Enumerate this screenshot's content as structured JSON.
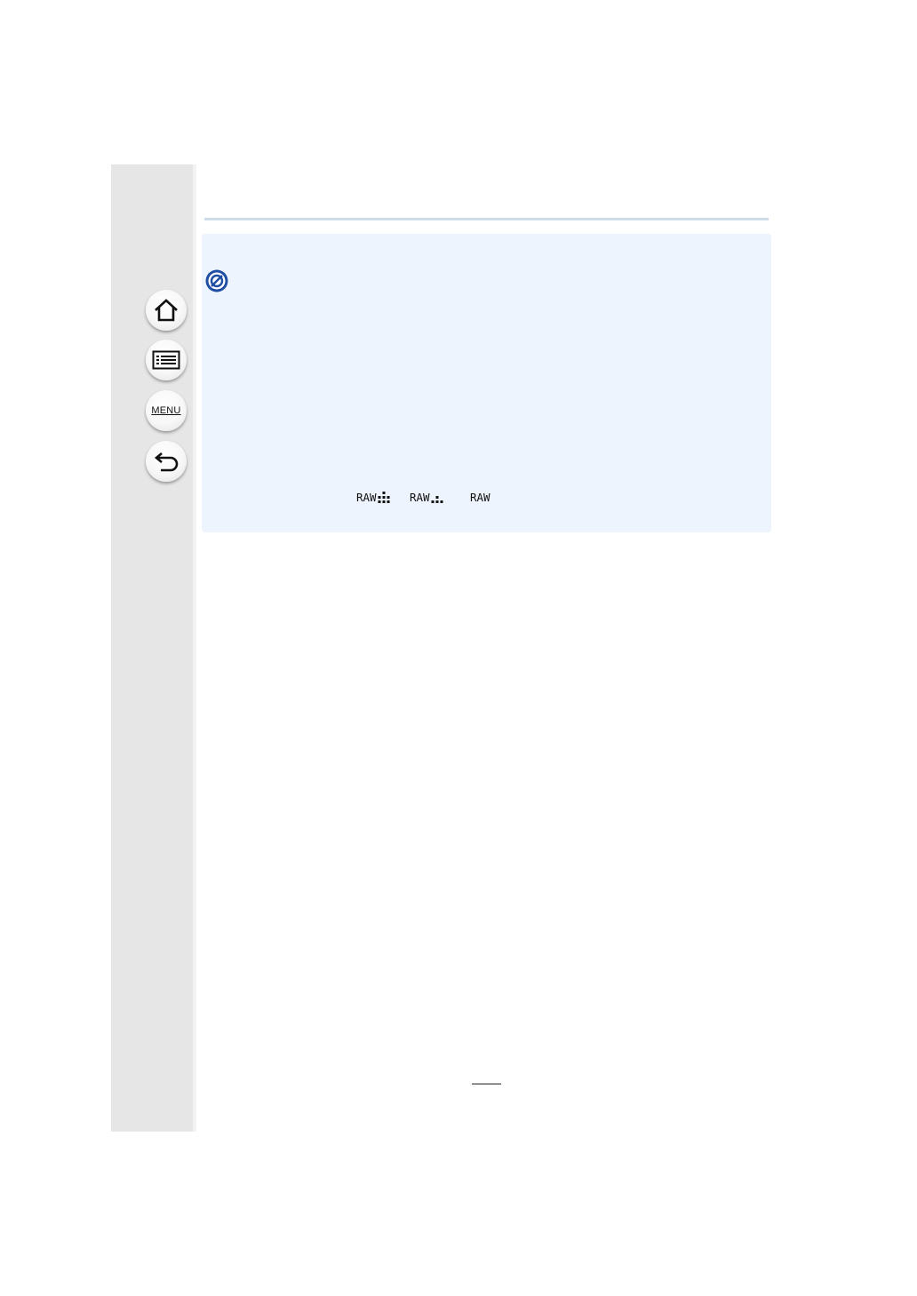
{
  "nav": {
    "home": {
      "icon": "home-icon"
    },
    "contents": {
      "icon": "list-icon"
    },
    "menu": {
      "label": "MENU"
    },
    "back": {
      "icon": "back-arrow-icon"
    }
  },
  "notice": {
    "icon": "not-available-icon",
    "raw_modes": [
      {
        "label": "RAW",
        "icon": "fine-quality-icon"
      },
      {
        "label": "RAW",
        "icon": "standard-quality-icon"
      },
      {
        "label": "RAW",
        "icon": ""
      }
    ]
  },
  "page_number": ""
}
